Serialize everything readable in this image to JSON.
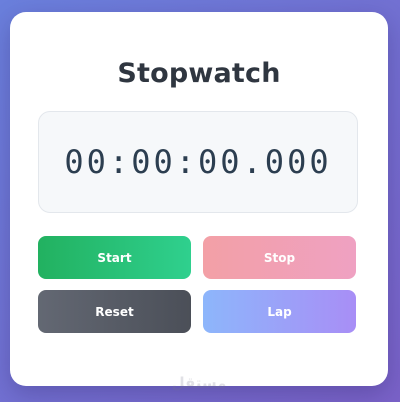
{
  "app": {
    "title": "Stopwatch"
  },
  "display": {
    "time": "00:00:00.000"
  },
  "buttons": {
    "start_label": "Start",
    "stop_label": "Stop",
    "reset_label": "Reset",
    "lap_label": "Lap"
  },
  "watermark": {
    "text": "مستقل"
  },
  "colors": {
    "background_gradient": [
      "#6a7fdc",
      "#7a62c8"
    ],
    "start": [
      "#22b160",
      "#2fd08e"
    ],
    "stop": [
      "#f3a0a6",
      "#efa1c2"
    ],
    "reset": [
      "#636873",
      "#4b4f58"
    ],
    "lap": [
      "#8db6fb",
      "#a88ef6"
    ],
    "title_text": "#2f3640",
    "time_text": "#2c3e50"
  }
}
